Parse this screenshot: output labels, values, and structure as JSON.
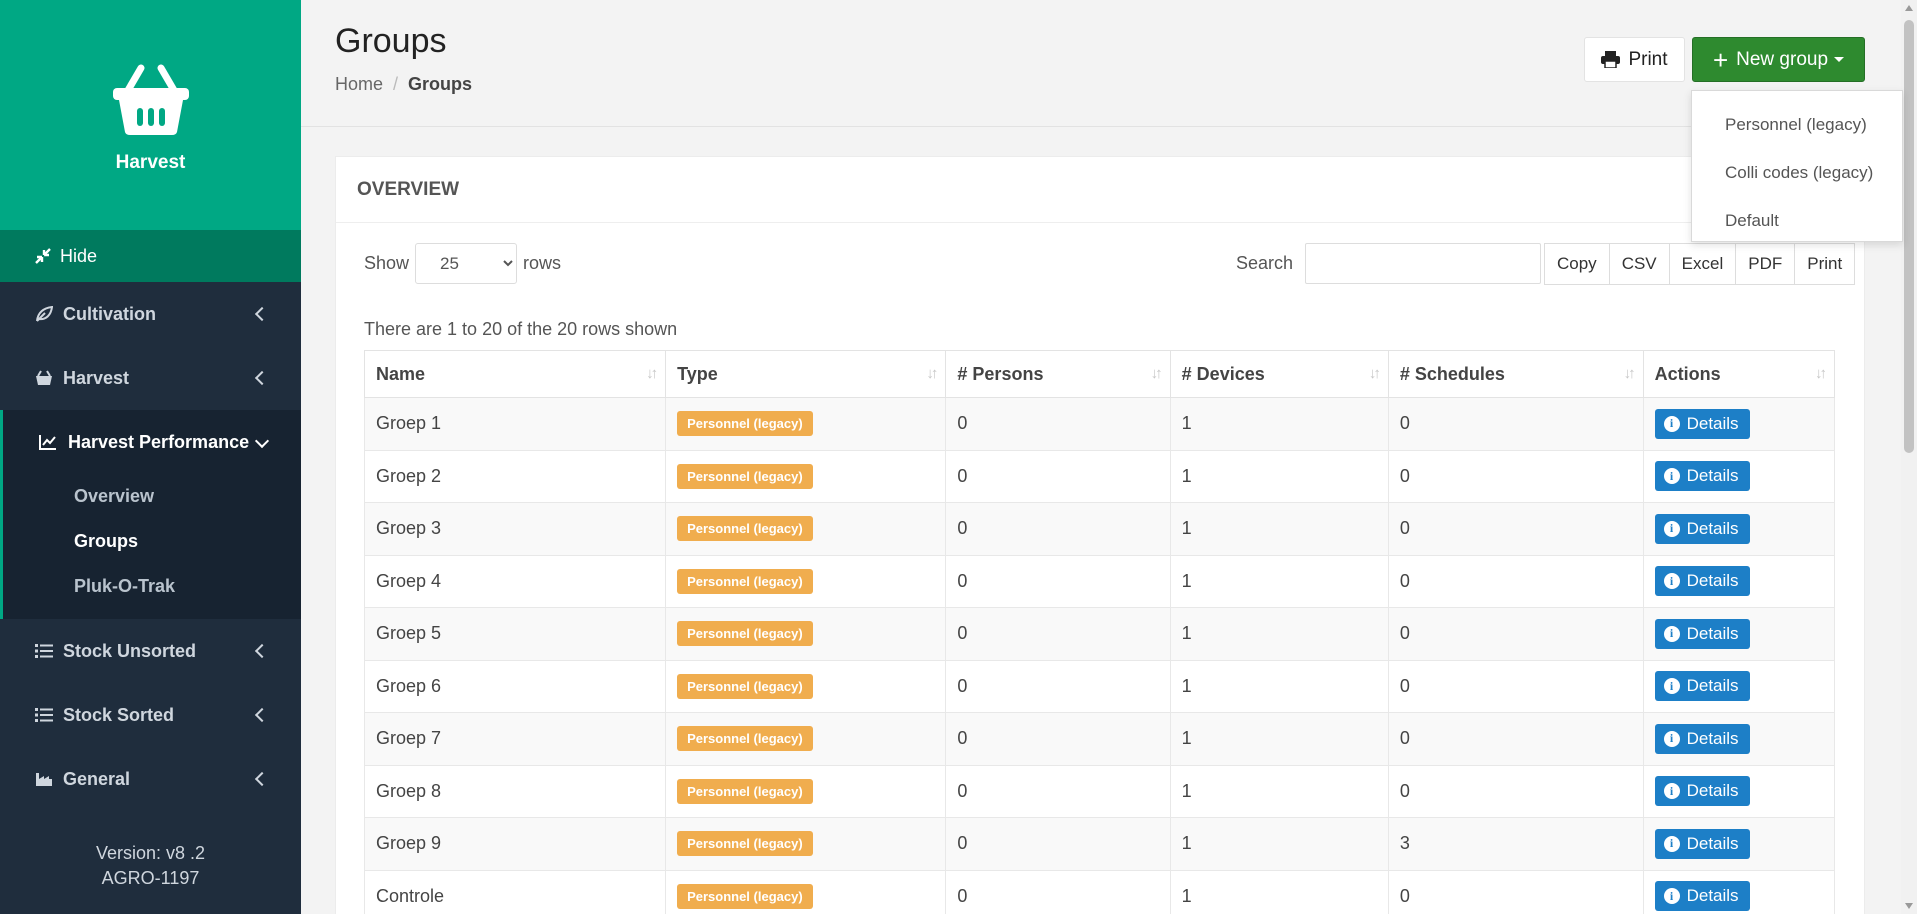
{
  "sidebar": {
    "brand_name": "Harvest",
    "hide_label": "Hide",
    "items": [
      {
        "label": "Cultivation",
        "icon": "leaf-icon"
      },
      {
        "label": "Harvest",
        "icon": "basket-icon"
      }
    ],
    "open_item": {
      "label": "Harvest Performance",
      "icon": "line-chart-icon",
      "children": [
        "Overview",
        "Groups",
        "Pluk-O-Trak"
      ],
      "active_child": "Groups"
    },
    "items_after": [
      {
        "label": "Stock Unsorted",
        "icon": "list-icon"
      },
      {
        "label": "Stock Sorted",
        "icon": "list-icon"
      },
      {
        "label": "General",
        "icon": "industry-icon"
      }
    ],
    "version_line1": "Version: v8 .2",
    "version_line2": "AGRO-1197"
  },
  "header": {
    "title": "Groups",
    "breadcrumb": {
      "home": "Home",
      "separator": "/",
      "current": "Groups"
    },
    "print_label": "Print",
    "new_group_label": "New group"
  },
  "dropdown": {
    "options": [
      "Personnel (legacy)",
      "Colli codes (legacy)",
      "Default"
    ]
  },
  "panel": {
    "title": "OVERVIEW",
    "show_label": "Show",
    "rows_label": "rows",
    "page_size": "25",
    "search_label": "Search",
    "search_value": "",
    "export_buttons": [
      "Copy",
      "CSV",
      "Excel",
      "PDF",
      "Print"
    ],
    "info_text": "There are 1 to 20 of the 20 rows shown"
  },
  "table": {
    "columns": [
      "Name",
      "Type",
      "# Persons",
      "# Devices",
      "# Schedules",
      "Actions"
    ],
    "action_label": "Details",
    "rows": [
      {
        "name": "Groep 1",
        "type": "Personnel (legacy)",
        "persons": "0",
        "devices": "1",
        "schedules": "0"
      },
      {
        "name": "Groep 2",
        "type": "Personnel (legacy)",
        "persons": "0",
        "devices": "1",
        "schedules": "0"
      },
      {
        "name": "Groep 3",
        "type": "Personnel (legacy)",
        "persons": "0",
        "devices": "1",
        "schedules": "0"
      },
      {
        "name": "Groep 4",
        "type": "Personnel (legacy)",
        "persons": "0",
        "devices": "1",
        "schedules": "0"
      },
      {
        "name": "Groep 5",
        "type": "Personnel (legacy)",
        "persons": "0",
        "devices": "1",
        "schedules": "0"
      },
      {
        "name": "Groep 6",
        "type": "Personnel (legacy)",
        "persons": "0",
        "devices": "1",
        "schedules": "0"
      },
      {
        "name": "Groep 7",
        "type": "Personnel (legacy)",
        "persons": "0",
        "devices": "1",
        "schedules": "0"
      },
      {
        "name": "Groep 8",
        "type": "Personnel (legacy)",
        "persons": "0",
        "devices": "1",
        "schedules": "0"
      },
      {
        "name": "Groep 9",
        "type": "Personnel (legacy)",
        "persons": "0",
        "devices": "1",
        "schedules": "3"
      },
      {
        "name": "Controle",
        "type": "Personnel (legacy)",
        "persons": "0",
        "devices": "1",
        "schedules": "0"
      }
    ]
  },
  "colors": {
    "brand": "#00a884",
    "sidebar": "#1f2d3d",
    "new_button": "#2e8a2f",
    "badge": "#f0ad4e",
    "details_button": "#1d7fc7"
  }
}
